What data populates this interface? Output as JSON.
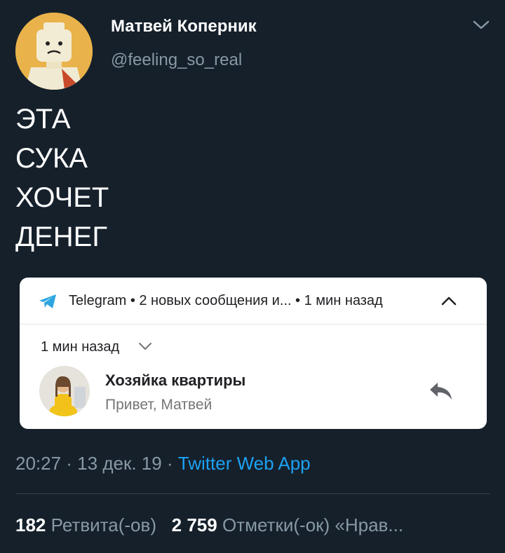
{
  "author": {
    "name": "Матвей Коперник",
    "handle": "@feeling_so_real"
  },
  "tweet": {
    "lines": [
      "ЭТА",
      "СУКА",
      "ХОЧЕТ",
      "ДЕНЕГ"
    ]
  },
  "notification": {
    "header_text": "Telegram • 2 новых сообщения и...  • 1 мин назад",
    "time": "1 мин назад",
    "contact_name": "Хозяйка квартиры",
    "message": "Привет, Матвей"
  },
  "meta": {
    "time_date": "20:27 · 13 дек. 19 · ",
    "source": "Twitter Web App"
  },
  "stats": {
    "retweets_count": "182",
    "retweets_label": " Ретвита(-ов)   ",
    "likes_count": "2 759",
    "likes_label": " Отметки(-ок) «Нрав..."
  },
  "colors": {
    "background": "#15202b",
    "text_secondary": "#8899a6",
    "link": "#1da1f2",
    "telegram": "#2ca5e0",
    "avatar_bg": "#e9b24a"
  },
  "icons": [
    "avatar-lego-figure",
    "chevron-down-icon",
    "telegram-icon",
    "chevron-up-icon",
    "chevron-down-icon",
    "reply-icon"
  ]
}
